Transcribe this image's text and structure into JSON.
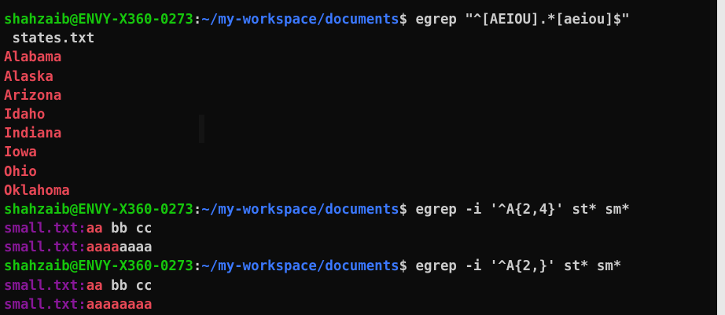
{
  "colors": {
    "background": "#0c0c0c",
    "user_host": "#16c60c",
    "path": "#3b78ff",
    "match": "#e74856",
    "filename": "#881798",
    "text": "#cccccc"
  },
  "prompt": {
    "user_host": "shahzaib@ENVY-X360-0273",
    "sep": ":",
    "path": "~/my-workspace/documents",
    "symbol": "$ "
  },
  "commands": [
    "egrep \"^[AEIOU].*[aeiou]$\"",
    "egrep -i '^A{2,4}' st* sm*",
    "egrep -i '^A{2,}' st* sm*"
  ],
  "wrap_continuation": " states.txt",
  "states_matches": [
    "Alabama",
    "Alaska",
    "Arizona",
    "Idaho",
    "Indiana",
    "Iowa",
    "Ohio",
    "Oklahoma"
  ],
  "output2": [
    {
      "file": "small.txt:",
      "match": "aa",
      "rest": " bb cc"
    },
    {
      "file": "small.txt:",
      "match": "aaaa",
      "rest": "aaaa"
    }
  ],
  "output3": [
    {
      "file": "small.txt:",
      "match": "aa",
      "rest": " bb cc"
    },
    {
      "file": "small.txt:",
      "match": "aaaaaaaa",
      "rest": ""
    }
  ]
}
